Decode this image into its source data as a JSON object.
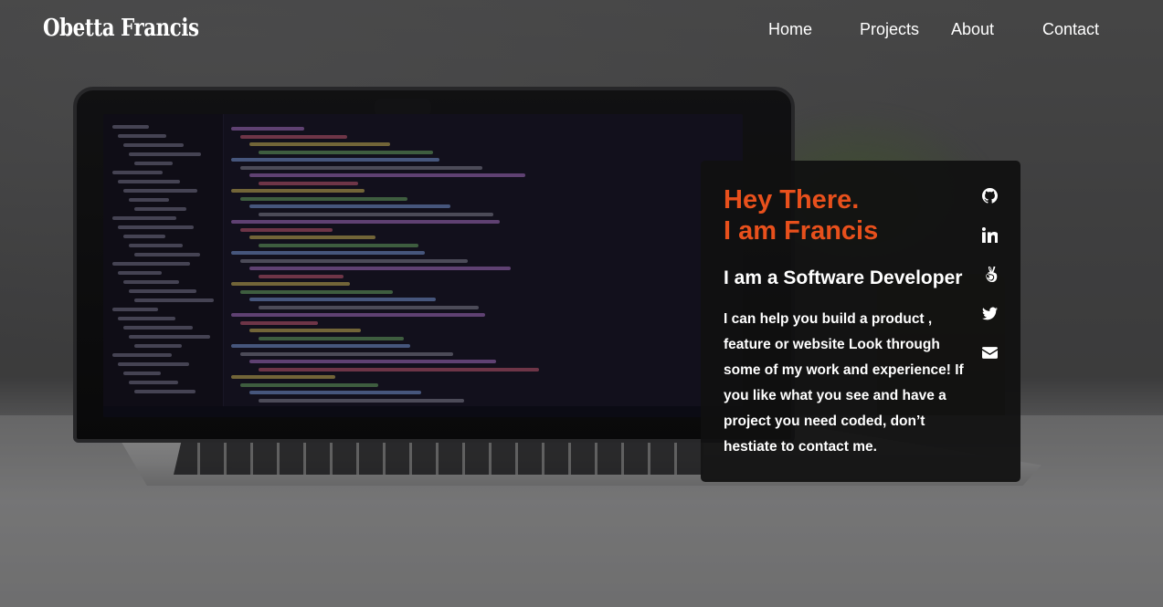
{
  "header": {
    "logo": "Obetta Francis",
    "nav": [
      {
        "label": "Home"
      },
      {
        "label": "Projects"
      },
      {
        "label": "About"
      },
      {
        "label": "Contact"
      }
    ]
  },
  "hero": {
    "greeting_line1": "Hey There.",
    "greeting_line2": "I am Francis",
    "role": "I am a Software Developer",
    "description": "I can help you build a product , feature or website Look through some of my work and experience! If you like what you see and have a project you need coded, don’t hestiate to contact me."
  },
  "social_icons": [
    "github-icon",
    "linkedin-icon",
    "angellist-icon",
    "twitter-icon",
    "email-icon"
  ],
  "colors": {
    "accent": "#e8501c",
    "card_background": "#101010",
    "text": "#ffffff"
  }
}
